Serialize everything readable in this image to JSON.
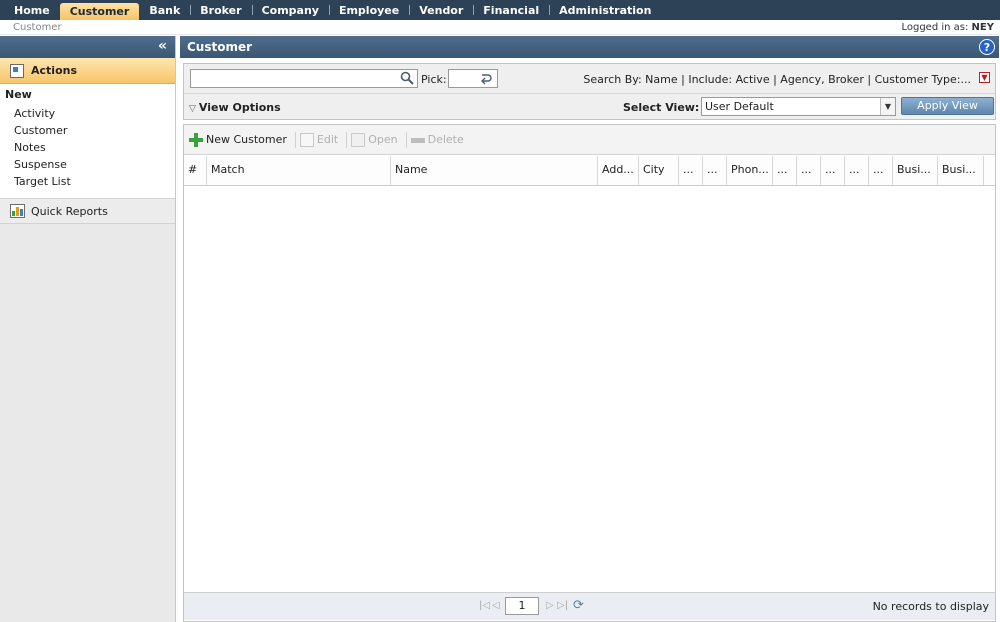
{
  "topnav": {
    "items": [
      {
        "label": "Home"
      },
      {
        "label": "Customer"
      },
      {
        "label": "Bank"
      },
      {
        "label": "Broker"
      },
      {
        "label": "Company"
      },
      {
        "label": "Employee"
      },
      {
        "label": "Vendor"
      },
      {
        "label": "Financial"
      },
      {
        "label": "Administration"
      }
    ],
    "active": "Customer"
  },
  "breadcrumb": "Customer",
  "login": {
    "prefix": "Logged in as:",
    "user": "NEY"
  },
  "sidebar": {
    "collapse_glyph": "«",
    "actions_title": "Actions",
    "new_label": "New",
    "items": [
      {
        "label": "Activity"
      },
      {
        "label": "Customer"
      },
      {
        "label": "Notes"
      },
      {
        "label": "Suspense"
      },
      {
        "label": "Target List"
      }
    ],
    "quick_reports": "Quick Reports"
  },
  "main": {
    "title": "Customer",
    "help_glyph": "?",
    "search": {
      "value": "",
      "pick_label": "Pick:",
      "search_by": "Search By: Name | Include: Active | Agency, Broker | Customer Type:..."
    },
    "view_options": "View Options",
    "select_view_label": "Select View:",
    "select_view_value": "User Default",
    "apply_view": "Apply View",
    "toolbar": {
      "new_customer": "New Customer",
      "edit": "Edit",
      "open": "Open",
      "delete": "Delete"
    },
    "columns": [
      "#",
      "Match",
      "Name",
      "Add...",
      "City",
      "...",
      "...",
      "Phon...",
      "...",
      "...",
      "...",
      "...",
      "...",
      "Busi...",
      "Busi..."
    ],
    "pager": {
      "page": "1",
      "status": "No records to display"
    }
  },
  "colors": {
    "nav_bg": "#2e4257",
    "accent_orange": "#f5c467",
    "header_blue": "#3a5773"
  }
}
